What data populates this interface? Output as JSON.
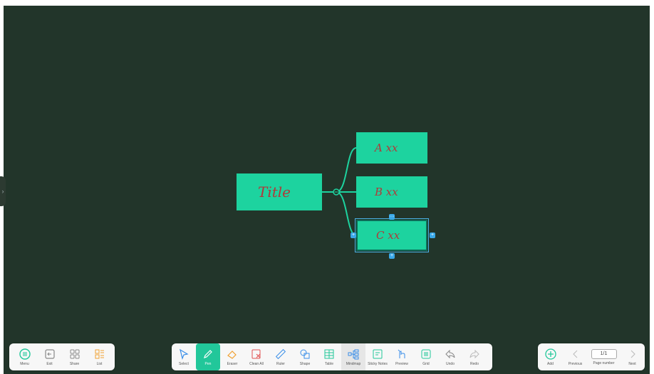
{
  "mindmap": {
    "title": "Title",
    "children": [
      "A xx",
      "B xx",
      "C xx"
    ]
  },
  "toolbar_left": [
    {
      "label": "Menu",
      "icon": "menu-icon"
    },
    {
      "label": "Exit",
      "icon": "exit-icon"
    },
    {
      "label": "Share",
      "icon": "share-icon"
    },
    {
      "label": "List",
      "icon": "list-icon"
    }
  ],
  "toolbar_main": [
    {
      "label": "Select",
      "icon": "select-icon"
    },
    {
      "label": "Pen",
      "icon": "pen-icon"
    },
    {
      "label": "Eraser",
      "icon": "eraser-icon"
    },
    {
      "label": "Clean All",
      "icon": "clean-all-icon"
    },
    {
      "label": "Ruler",
      "icon": "ruler-icon"
    },
    {
      "label": "Shape",
      "icon": "shape-icon"
    },
    {
      "label": "Table",
      "icon": "table-icon"
    },
    {
      "label": "Mindmap",
      "icon": "mindmap-icon"
    },
    {
      "label": "Sticky Notes",
      "icon": "sticky-notes-icon"
    },
    {
      "label": "Preview",
      "icon": "preview-icon"
    },
    {
      "label": "Grid",
      "icon": "grid-icon"
    },
    {
      "label": "Undo",
      "icon": "undo-icon"
    },
    {
      "label": "Redo",
      "icon": "redo-icon"
    }
  ],
  "toolbar_right": {
    "add_label": "Add",
    "previous_label": "Previous",
    "page_value": "1/1",
    "page_number_label": "Page number",
    "next_label": "Next"
  },
  "colors": {
    "board": "#22352a",
    "node": "#1dd39f",
    "node_text": "#b03a3a",
    "accent": "#22c79a",
    "selection": "#3aa8e8"
  }
}
